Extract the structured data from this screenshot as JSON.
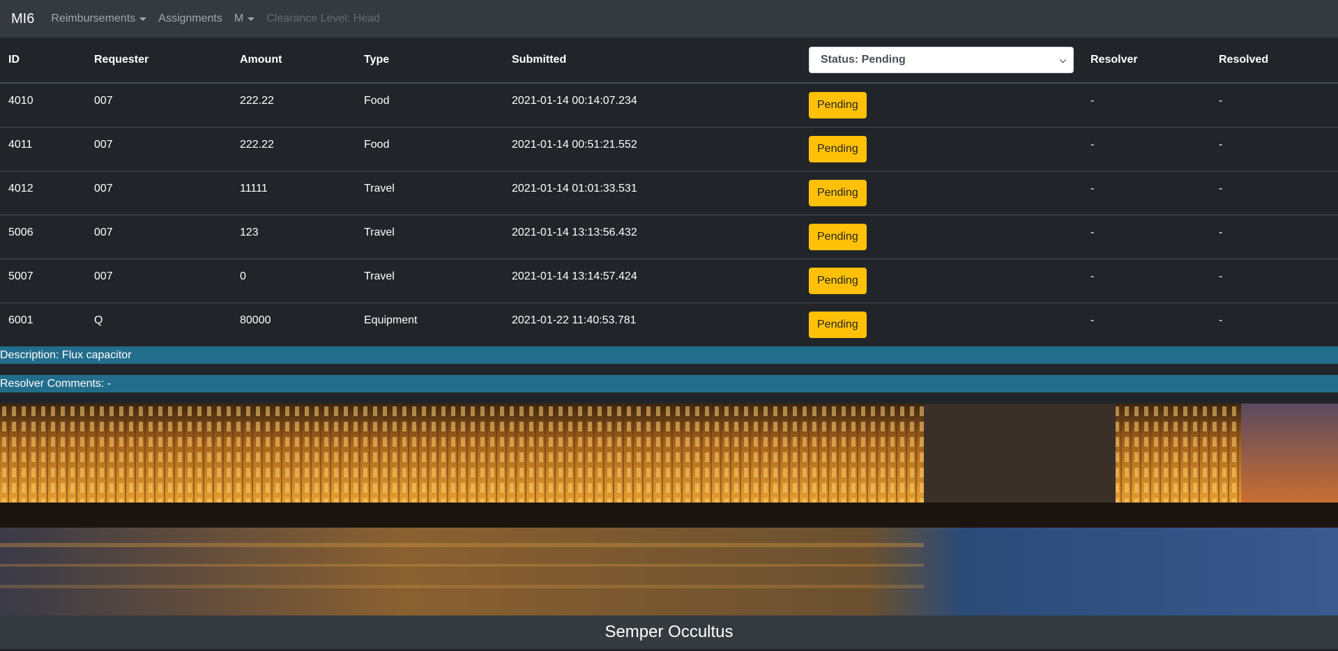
{
  "nav": {
    "brand": "MI6",
    "reimbursements": "Reimbursements",
    "assignments": "Assignments",
    "user": "M",
    "clearance": "Clearance Level: Head"
  },
  "table": {
    "headers": {
      "id": "ID",
      "requester": "Requester",
      "amount": "Amount",
      "type": "Type",
      "submitted": "Submitted",
      "resolver": "Resolver",
      "resolved": "Resolved"
    },
    "status_filter": "Status: Pending",
    "rows": [
      {
        "id": "4010",
        "requester": "007",
        "amount": "222.22",
        "type": "Food",
        "submitted": "2021-01-14 00:14:07.234",
        "status": "Pending",
        "resolver": "-",
        "resolved": "-"
      },
      {
        "id": "4011",
        "requester": "007",
        "amount": "222.22",
        "type": "Food",
        "submitted": "2021-01-14 00:51:21.552",
        "status": "Pending",
        "resolver": "-",
        "resolved": "-"
      },
      {
        "id": "4012",
        "requester": "007",
        "amount": "11111",
        "type": "Travel",
        "submitted": "2021-01-14 01:01:33.531",
        "status": "Pending",
        "resolver": "-",
        "resolved": "-"
      },
      {
        "id": "5006",
        "requester": "007",
        "amount": "123",
        "type": "Travel",
        "submitted": "2021-01-14 13:13:56.432",
        "status": "Pending",
        "resolver": "-",
        "resolved": "-"
      },
      {
        "id": "5007",
        "requester": "007",
        "amount": "0",
        "type": "Travel",
        "submitted": "2021-01-14 13:14:57.424",
        "status": "Pending",
        "resolver": "-",
        "resolved": "-"
      },
      {
        "id": "6001",
        "requester": "Q",
        "amount": "80000",
        "type": "Equipment",
        "submitted": "2021-01-22 11:40:53.781",
        "status": "Pending",
        "resolver": "-",
        "resolved": "-"
      }
    ]
  },
  "details": {
    "description": "Description: Flux capacitor",
    "resolver_comments": "Resolver Comments: -"
  },
  "footer": {
    "motto": "Semper Occultus"
  },
  "colors": {
    "navbar": "#343a40",
    "background": "#212529",
    "pending": "#ffc107",
    "info_bar": "#236d8c"
  }
}
